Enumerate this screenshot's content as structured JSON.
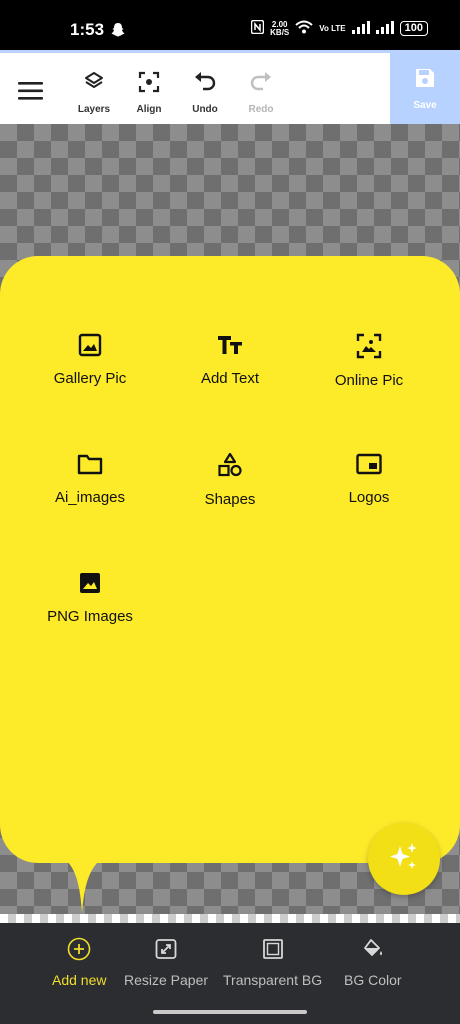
{
  "status_bar": {
    "time": "1:53",
    "speed_value": "2.00",
    "speed_unit": "KB/S",
    "network": "Vo LTE",
    "battery": "100",
    "icons": [
      "snapchat-ghost-icon",
      "nfc-icon",
      "wifi-icon",
      "signal-icon",
      "signal-icon",
      "battery-icon"
    ]
  },
  "toolbar": {
    "menu_icon": "hamburger-menu-icon",
    "layers_label": "Layers",
    "align_label": "Align",
    "undo_label": "Undo",
    "redo_label": "Redo",
    "save_label": "Save",
    "redo_enabled": false
  },
  "add_panel": {
    "items": [
      {
        "label": "Gallery Pic",
        "icon": "image-icon"
      },
      {
        "label": "Add Text",
        "icon": "text-icon"
      },
      {
        "label": "Online Pic",
        "icon": "image-search-icon"
      },
      {
        "label": "Ai_images",
        "icon": "folder-icon"
      },
      {
        "label": "Shapes",
        "icon": "shapes-icon"
      },
      {
        "label": "Logos",
        "icon": "picture-in-picture-icon"
      },
      {
        "label": "PNG Images",
        "icon": "image-filled-icon"
      }
    ],
    "fab_icon": "sparkle-icon"
  },
  "bottom_bar": {
    "items": [
      {
        "label": "Add new",
        "icon": "add-circle-icon",
        "active": true
      },
      {
        "label": "Resize Paper",
        "icon": "resize-icon",
        "active": false
      },
      {
        "label": "Transparent BG",
        "icon": "transparent-bg-icon",
        "active": false
      },
      {
        "label": "BG Color",
        "icon": "paint-bucket-icon",
        "active": false
      }
    ]
  },
  "colors": {
    "panel": "#fdea29",
    "save_button": "#b7d2ff",
    "bottom_bar": "#2b2d31",
    "active_accent": "#f0de2a"
  }
}
